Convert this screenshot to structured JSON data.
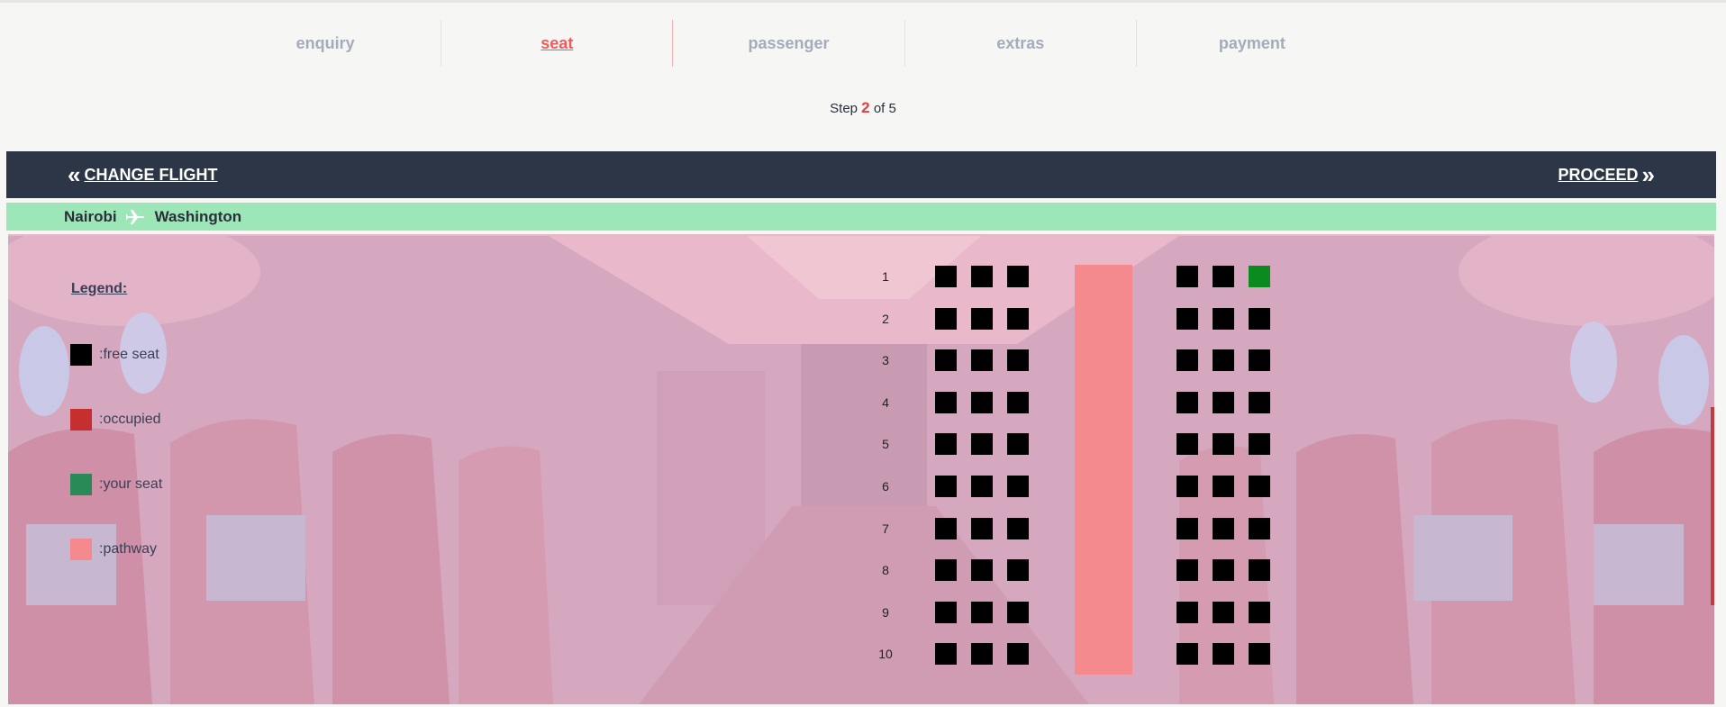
{
  "steps": [
    "enquiry",
    "seat",
    "passenger",
    "extras",
    "payment"
  ],
  "active_step": "seat",
  "stepinfo": {
    "prefix": "Step",
    "current": "2",
    "suffix": "of 5"
  },
  "nav": {
    "back_label": "CHANGE FLIGHT",
    "forward_label": "PROCEED"
  },
  "route": {
    "from": "Nairobi",
    "to": "Washington"
  },
  "legend": {
    "title": "Legend:",
    "items": [
      {
        "label": ":free seat",
        "color": "#000000"
      },
      {
        "label": ":occupied",
        "color": "#c62f2f"
      },
      {
        "label": ":your seat",
        "color": "#2a8a57"
      },
      {
        "label": ":pathway",
        "color": "#f58a8e"
      }
    ]
  },
  "seatmap": {
    "rows": [
      "1",
      "2",
      "3",
      "4",
      "5",
      "6",
      "7",
      "8",
      "9",
      "10"
    ],
    "seats_per_side": 3,
    "selected": {
      "row": "1",
      "seat_index": 5
    },
    "colors": {
      "free": "#000000",
      "selected": "#0a8a1f",
      "pathway": "#f58a8e"
    }
  }
}
